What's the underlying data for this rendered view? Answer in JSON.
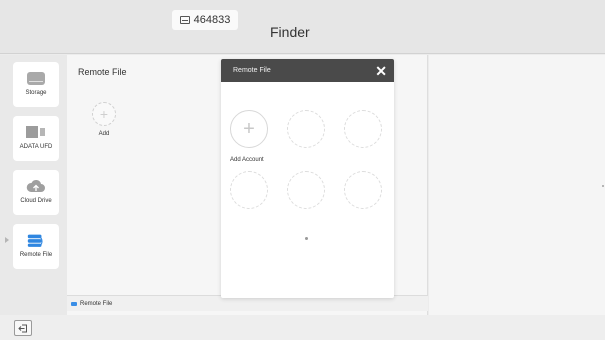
{
  "header": {
    "code": "464833",
    "title": "Finder"
  },
  "sidebar": {
    "items": [
      {
        "label": "Storage",
        "icon": "storage-icon"
      },
      {
        "label": "ADATA UFD",
        "icon": "usb-drive-icon"
      },
      {
        "label": "Cloud Drive",
        "icon": "cloud-upload-icon"
      },
      {
        "label": "Remote File",
        "icon": "remote-file-icon"
      }
    ]
  },
  "main": {
    "title": "Remote File",
    "add_label": "Add",
    "status_label": "Remote File"
  },
  "dialog": {
    "title": "Remote File",
    "close_symbol": "✕",
    "add_account_label": "Add Account",
    "slot_count": 6
  },
  "colors": {
    "accent_blue": "#3a8ee6",
    "dialog_header": "#4a4a4a"
  }
}
